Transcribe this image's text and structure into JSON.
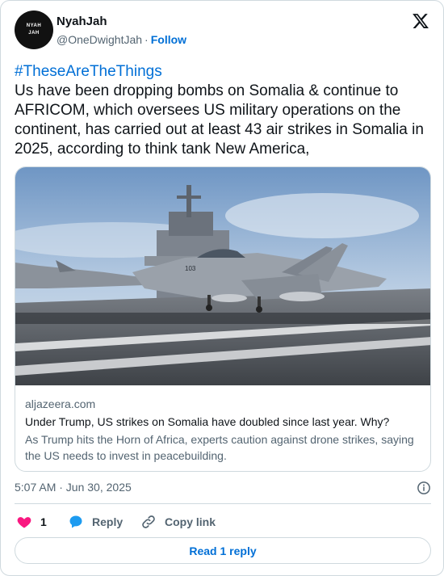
{
  "author": {
    "name": "NyahJah",
    "handle": "@OneDwightJah",
    "follow_label": "Follow",
    "avatar_line1": "NYAH",
    "avatar_line2": "JAH",
    "avatar_bg": "#111111"
  },
  "tweet": {
    "hashtag": "#TheseAreTheThings",
    "body": "Us have been dropping bombs on Somalia & continue to AFRICOM, which oversees US military operations on the continent, has carried out at least 43 air strikes in Somalia in 2025, according to think tank New America,"
  },
  "link_card": {
    "image": "fighter-jet-on-aircraft-carrier-deck",
    "domain": "aljazeera.com",
    "title": "Under Trump, US strikes on Somalia have doubled since last year. Why?",
    "description": "As Trump hits the Horn of Africa, experts caution against drone strikes, saying the US needs to invest in peacebuilding."
  },
  "meta": {
    "timestamp": "5:07 AM · Jun 30, 2025"
  },
  "actions": {
    "like_count": "1",
    "reply_label": "Reply",
    "copy_link_label": "Copy link"
  },
  "read_reply_label": "Read 1 reply",
  "icons": {
    "logo": "x-logo-icon",
    "info": "info-icon",
    "like": "heart-icon",
    "reply": "reply-bubble-icon",
    "copy": "link-icon"
  },
  "colors": {
    "link_blue": "#006fd6",
    "like_pink": "#f91880",
    "reply_blue": "#1d9bf0",
    "muted": "#536471",
    "border": "#cfd9de"
  }
}
